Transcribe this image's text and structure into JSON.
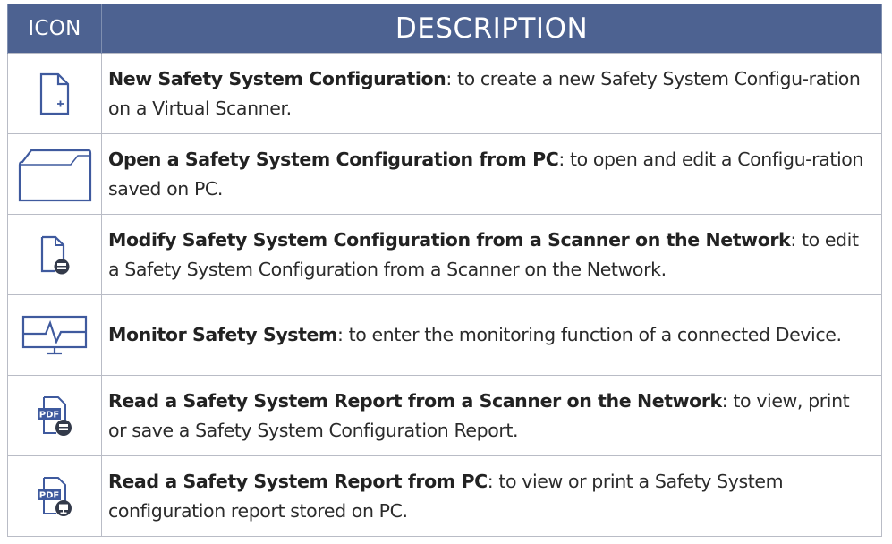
{
  "header": {
    "icon_col": "ICON",
    "desc_col": "DESCRIPTION"
  },
  "rows": [
    {
      "icon": "new-document-icon",
      "term": "New Safety System Configuration",
      "desc": ": to create a new Safety System Configu-ration on a Virtual Scanner."
    },
    {
      "icon": "folder-icon",
      "term": "Open a Safety System Configuration from PC",
      "desc": ": to open and edit a Configu-ration saved on PC."
    },
    {
      "icon": "document-network-scanner-icon",
      "term": "Modify Safety System Configuration from a Scanner on the Network",
      "desc": ": to edit a Safety System Configuration from a Scanner on the Network."
    },
    {
      "icon": "monitor-pulse-icon",
      "term": "Monitor Safety System",
      "desc": ": to enter the monitoring function of a connected Device."
    },
    {
      "icon": "pdf-network-scanner-icon",
      "term": "Read a Safety System Report from a Scanner on the Network",
      "desc": ": to view, print or save a Safety System Configuration Report.",
      "icon_text": "PDF"
    },
    {
      "icon": "pdf-pc-icon",
      "term": "Read a Safety System Report from PC",
      "desc": ": to view or print a Safety System configuration report stored on PC.",
      "icon_text": "PDF"
    }
  ],
  "colors": {
    "header_bg": "#4d6291",
    "header_text": "#ffffff",
    "icon_blue": "#3f5a9e"
  }
}
